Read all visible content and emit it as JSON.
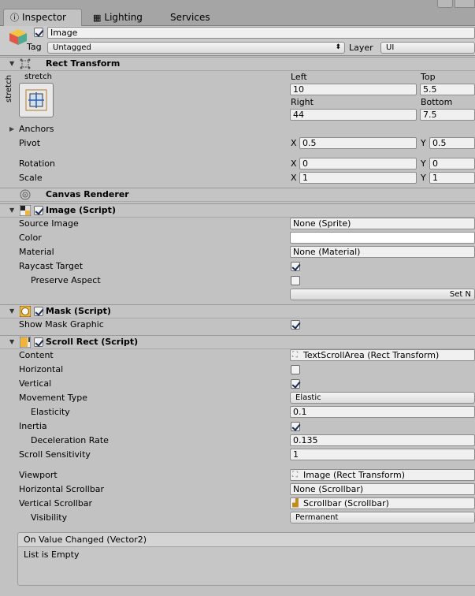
{
  "tabs": [
    {
      "label": "Inspector"
    },
    {
      "label": "Lighting"
    },
    {
      "label": "Services"
    }
  ],
  "gameobject": {
    "name": "Image",
    "tag_label": "Tag",
    "tag_value": "Untagged",
    "layer_label": "Layer",
    "layer_value": "UI"
  },
  "rect_transform": {
    "title": "Rect Transform",
    "anchor_top": "stretch",
    "anchor_side": "stretch",
    "left_label": "Left",
    "left_value": "10",
    "top_label": "Top",
    "top_value": "5.5",
    "right_label": "Right",
    "right_value": "44",
    "bottom_label": "Bottom",
    "bottom_value": "7.5",
    "anchors_label": "Anchors",
    "pivot_label": "Pivot",
    "pivot_x": "0.5",
    "pivot_y": "0.5",
    "rotation_label": "Rotation",
    "rotation_x": "0",
    "rotation_y": "0",
    "scale_label": "Scale",
    "scale_x": "1",
    "scale_y": "1",
    "x_label": "X",
    "y_label": "Y"
  },
  "canvas_renderer": {
    "title": "Canvas Renderer"
  },
  "image_script": {
    "title": "Image (Script)",
    "source_image_label": "Source Image",
    "source_image_value": "None (Sprite)",
    "color_label": "Color",
    "material_label": "Material",
    "material_value": "None (Material)",
    "raycast_label": "Raycast Target",
    "preserve_label": "Preserve Aspect",
    "set_native_label": "Set N"
  },
  "mask_script": {
    "title": "Mask (Script)",
    "show_graphic_label": "Show Mask Graphic"
  },
  "scroll_rect": {
    "title": "Scroll Rect (Script)",
    "content_label": "Content",
    "content_value": "TextScrollArea (Rect Transform)",
    "horizontal_label": "Horizontal",
    "vertical_label": "Vertical",
    "movement_label": "Movement Type",
    "movement_value": "Elastic",
    "elasticity_label": "Elasticity",
    "elasticity_value": "0.1",
    "inertia_label": "Inertia",
    "decel_label": "Deceleration Rate",
    "decel_value": "0.135",
    "sensitivity_label": "Scroll Sensitivity",
    "sensitivity_value": "1",
    "viewport_label": "Viewport",
    "viewport_value": "Image (Rect Transform)",
    "hscroll_label": "Horizontal Scrollbar",
    "hscroll_value": "None (Scrollbar)",
    "vscroll_label": "Vertical Scrollbar",
    "vscroll_value": "Scrollbar (Scrollbar)",
    "visibility_label": "Visibility",
    "visibility_value": "Permanent",
    "event_title": "On Value Changed (Vector2)",
    "event_empty": "List is Empty"
  },
  "colors": {
    "panel_bg": "#c2c2c2",
    "tabbar_bg": "#a5a5a5",
    "field_bg": "#f0f0f0",
    "color_field": "#ffffff"
  }
}
